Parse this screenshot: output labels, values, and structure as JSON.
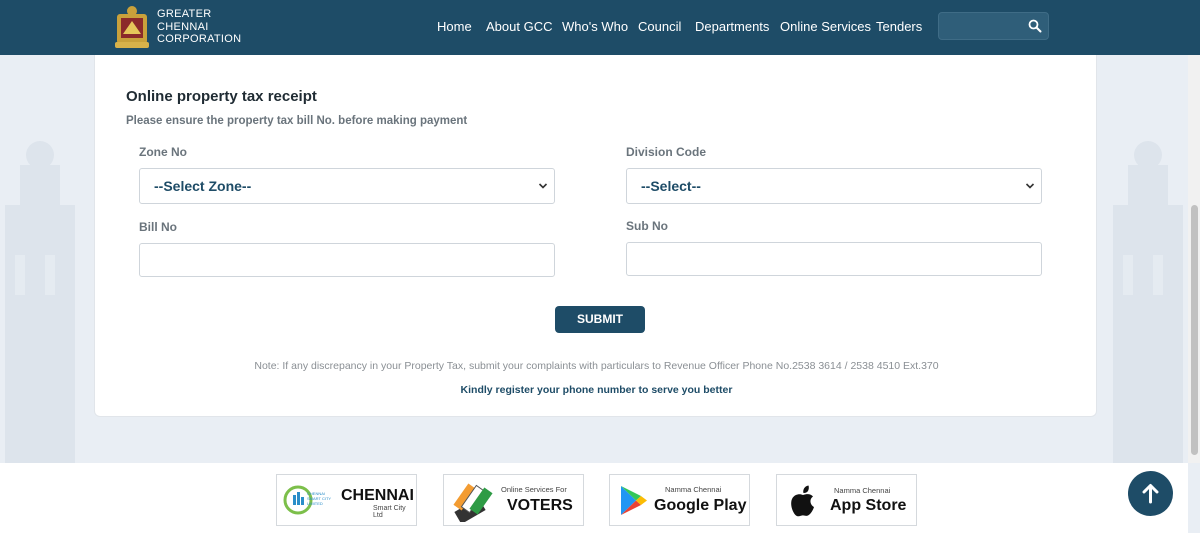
{
  "header": {
    "brand_line1": "GREATER",
    "brand_line2": "CHENNAI",
    "brand_line3": "CORPORATION",
    "nav": [
      "Home",
      "About GCC",
      "Who's Who",
      "Council",
      "Departments",
      "Online Services",
      "Tenders"
    ],
    "search_placeholder": ""
  },
  "form": {
    "title": "Online property tax receipt",
    "subtitle": "Please ensure the property tax bill No. before making payment",
    "zone_label": "Zone No",
    "zone_value": "--Select Zone--",
    "division_label": "Division Code",
    "division_value": "--Select--",
    "bill_label": "Bill No",
    "bill_value": "",
    "sub_label": "Sub No",
    "sub_value": "",
    "submit_label": "SUBMIT",
    "note": "Note: If any discrepancy in your Property Tax, submit your complaints with particulars to Revenue Officer Phone No.2538 3614 / 2538 4510 Ext.370",
    "register_text": "Kindly register your phone number to serve you better"
  },
  "footer": {
    "smart_city": {
      "top": "CHENNAI SMART CITY LIMITED",
      "big": "CHENNAI",
      "small": "Smart City Ltd"
    },
    "voters": {
      "small": "Online Services For",
      "big": "VOTERS"
    },
    "google_play": {
      "small": "Namma Chennai",
      "big": "Google Play"
    },
    "app_store": {
      "small": "Namma Chennai",
      "big": "App Store"
    }
  },
  "colors": {
    "primary": "#1e4c67",
    "page_bg": "#e9eef4"
  },
  "icons": [
    "gcc-emblem-icon",
    "search-icon",
    "chevron-down-icon",
    "smart-city-logo-icon",
    "voter-logo-icon",
    "google-play-icon",
    "apple-icon",
    "arrow-up-icon"
  ]
}
